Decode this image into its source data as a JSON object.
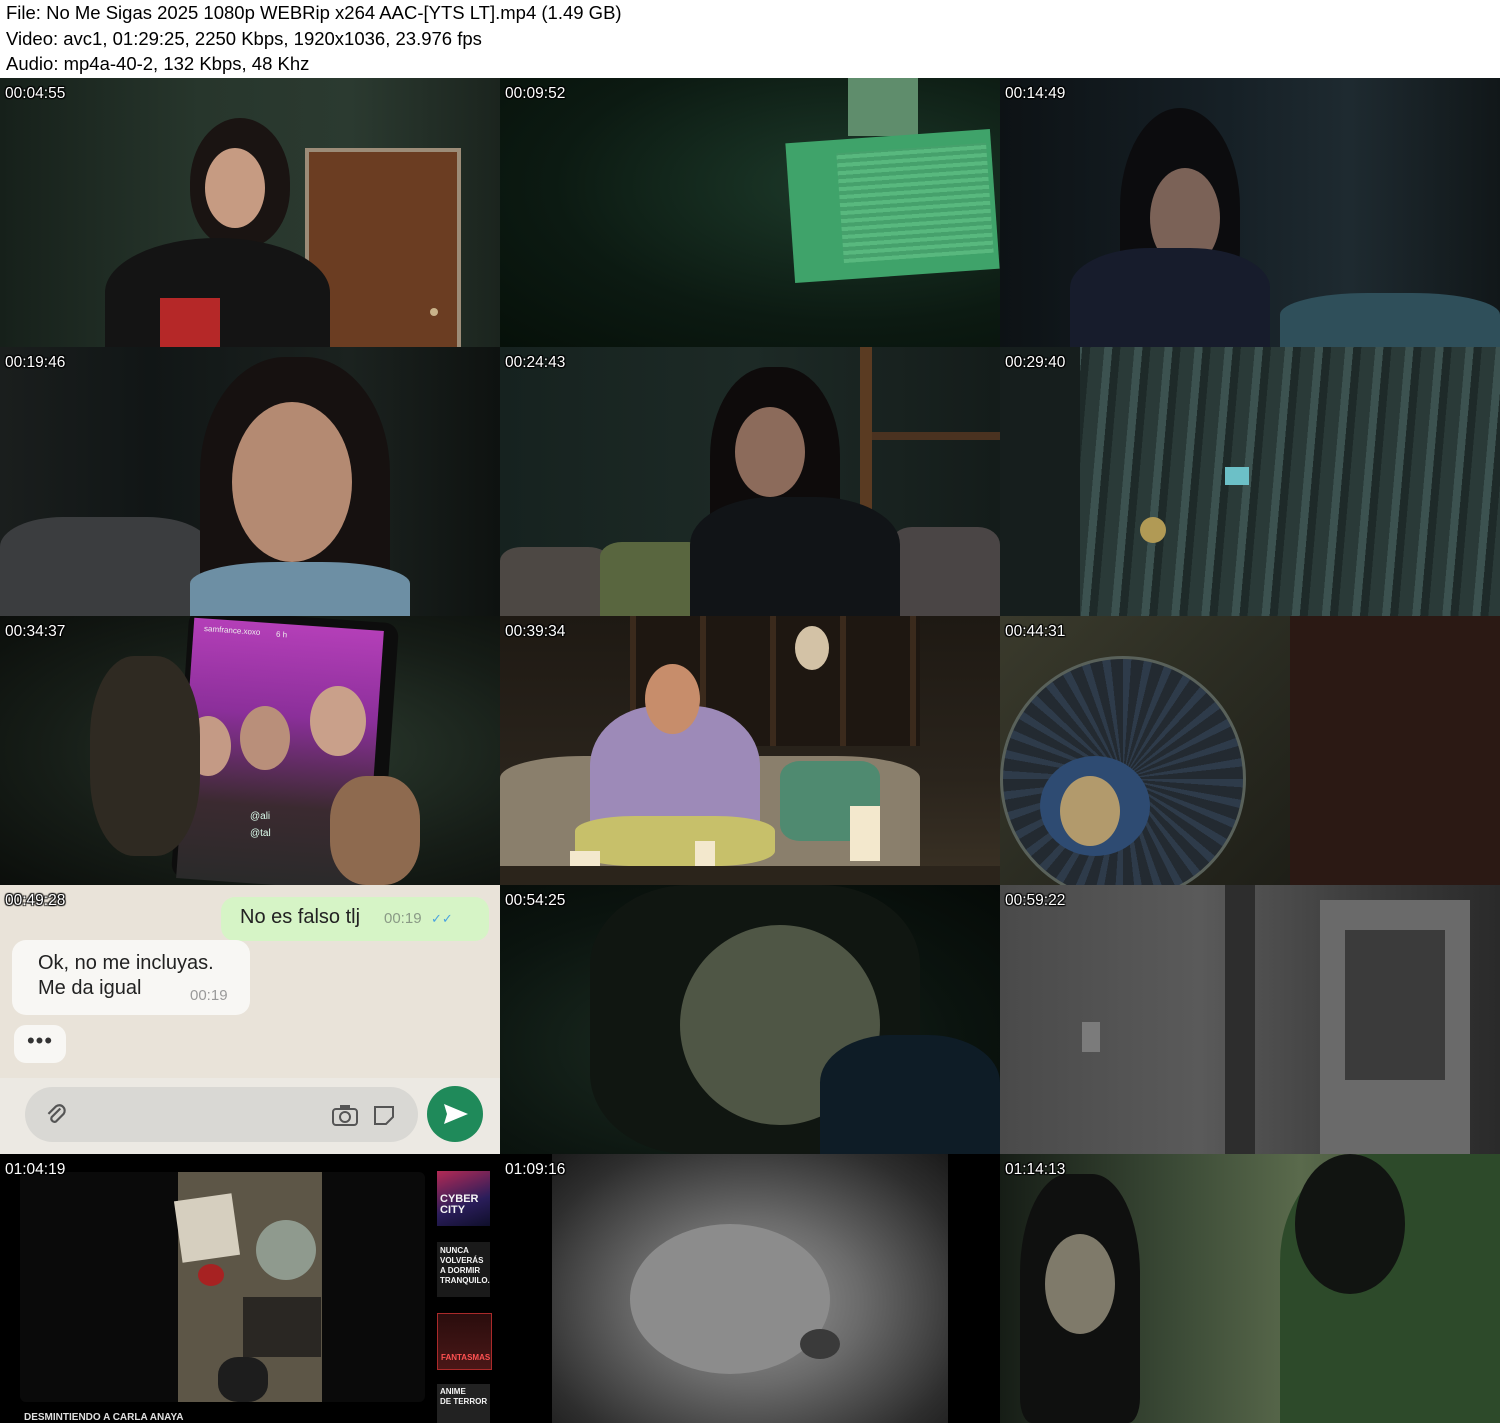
{
  "header": {
    "file": "File: No Me Sigas 2025 1080p WEBRip x264 AAC-[YTS LT].mp4 (1.49 GB)",
    "video": "Video: avc1, 01:29:25, 2250 Kbps, 1920x1036, 23.976 fps",
    "audio": "Audio: mp4a-40-2, 132 Kbps, 48 Khz"
  },
  "frames": [
    {
      "timestamp": "00:04:55"
    },
    {
      "timestamp": "00:09:52"
    },
    {
      "timestamp": "00:14:49"
    },
    {
      "timestamp": "00:19:46"
    },
    {
      "timestamp": "00:24:43"
    },
    {
      "timestamp": "00:29:40"
    },
    {
      "timestamp": "00:34:37"
    },
    {
      "timestamp": "00:39:34"
    },
    {
      "timestamp": "00:44:31"
    },
    {
      "timestamp": "00:49:28"
    },
    {
      "timestamp": "00:54:25"
    },
    {
      "timestamp": "00:59:22"
    },
    {
      "timestamp": "01:04:19"
    },
    {
      "timestamp": "01:09:16"
    },
    {
      "timestamp": "01:14:13"
    }
  ],
  "chat": {
    "outgoing_text": "No es falso tlj",
    "outgoing_time": "00:19",
    "incoming_line1": "Ok, no me incluyas.",
    "incoming_line2": "Me da igual",
    "incoming_time": "00:19",
    "typing": "•••"
  },
  "phone_story": {
    "username": "samfrance.xoxo",
    "age": "6 h",
    "tag1": "@ali",
    "tag2": "@tal"
  },
  "menu": {
    "thumb1": "CYBER\nCITY",
    "thumb2": "NUNCA\nVOLVERÁS\nA DORMIR\nTRANQUILO...",
    "thumb3": "FANTASMAS",
    "thumb4": "ANIME\nDE TERROR",
    "caption": "DESMINTIENDO A CARLA ANAYA"
  }
}
